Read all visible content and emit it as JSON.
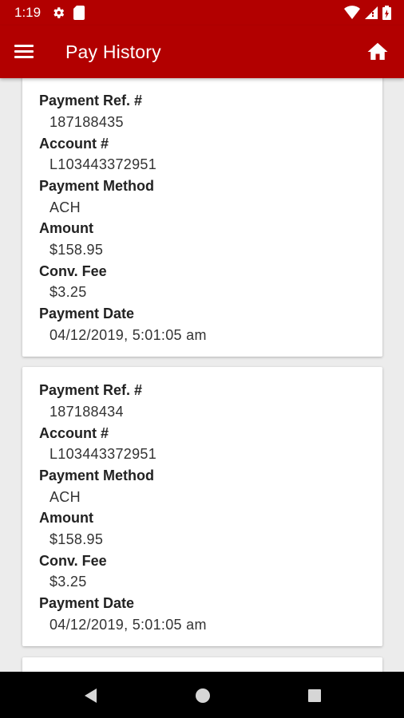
{
  "status_bar": {
    "time": "1:19",
    "left_icons": [
      "settings-icon",
      "sd-card-icon"
    ],
    "right_icons": [
      "wifi-icon",
      "signal-icon",
      "battery-icon"
    ]
  },
  "app_bar": {
    "title": "Pay History",
    "menu_icon": "hamburger-menu-icon",
    "home_icon": "home-icon"
  },
  "labels": {
    "payment_ref": "Payment Ref. #",
    "account": "Account #",
    "payment_method": "Payment Method",
    "amount": "Amount",
    "conv_fee": "Conv. Fee",
    "payment_date": "Payment Date"
  },
  "payments": [
    {
      "payment_ref": "187188435",
      "account": "L103443372951",
      "payment_method": "ACH",
      "amount": "$158.95",
      "conv_fee": "$3.25",
      "payment_date": "04/12/2019, 5:01:05 am"
    },
    {
      "payment_ref": "187188434",
      "account": "L103443372951",
      "payment_method": "ACH",
      "amount": "$158.95",
      "conv_fee": "$3.25",
      "payment_date": "04/12/2019, 5:01:05 am"
    }
  ],
  "nav_bar": {
    "buttons": [
      "back-icon",
      "home-circle-icon",
      "recents-square-icon"
    ]
  },
  "colors": {
    "primary": "#b20000",
    "background": "#ececec",
    "card": "#ffffff",
    "nav_bar": "#000000"
  }
}
